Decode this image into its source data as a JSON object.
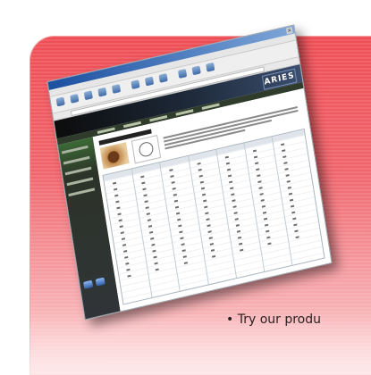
{
  "promo": {
    "text": "• Try our produ"
  },
  "window": {
    "logo_text": "ARIES",
    "close_icon": "close-icon"
  },
  "colors": {
    "card_red": "#ef4e55",
    "card_light": "#fbd3d5",
    "banner_dark": "#0c0c0c",
    "sidebar_green": "#3b6a36"
  }
}
